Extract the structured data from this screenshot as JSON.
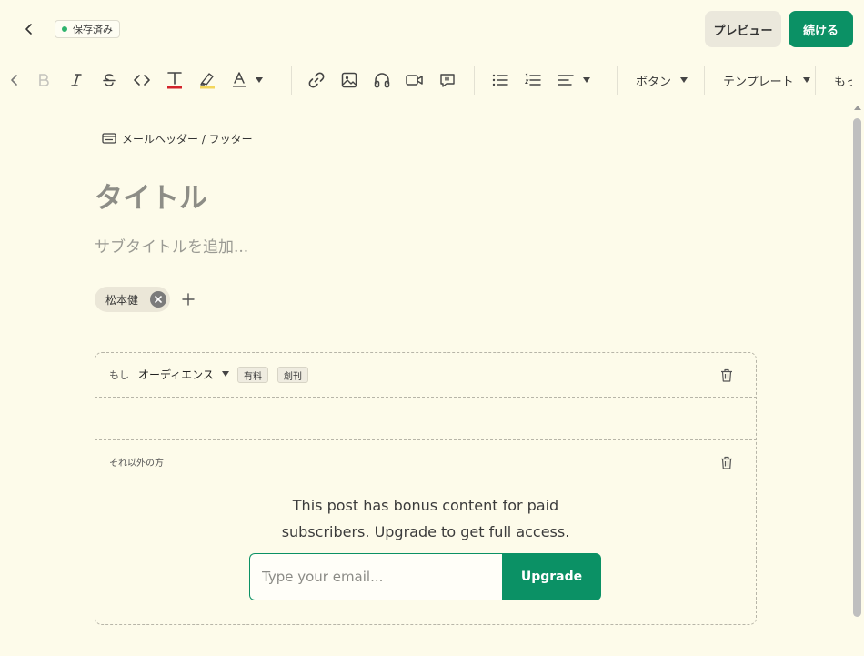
{
  "header": {
    "saved_label": "保存済み",
    "preview_label": "プレビュー",
    "continue_label": "続ける",
    "accent_color": "#0b9165",
    "saved_dot_color": "#2fb36d"
  },
  "toolbar": {
    "buttons_dropdown": "ボタン",
    "templates_dropdown": "テンプレート",
    "more_dropdown": "もっと見る"
  },
  "editor": {
    "header_footer_link": "メールヘッダー / フッター",
    "title_placeholder": "タイトル",
    "subtitle_placeholder": "サブタイトルを追加...",
    "author_name": "松本健"
  },
  "conditional": {
    "if_label": "もし",
    "audience_label": "オーディエンス",
    "tags": [
      "有料",
      "創刊"
    ],
    "else_label": "それ以外の方",
    "paywall_line1": "This post has bonus content for paid",
    "paywall_line2": "subscribers. Upgrade to get full access.",
    "email_placeholder": "Type your email...",
    "upgrade_label": "Upgrade"
  }
}
